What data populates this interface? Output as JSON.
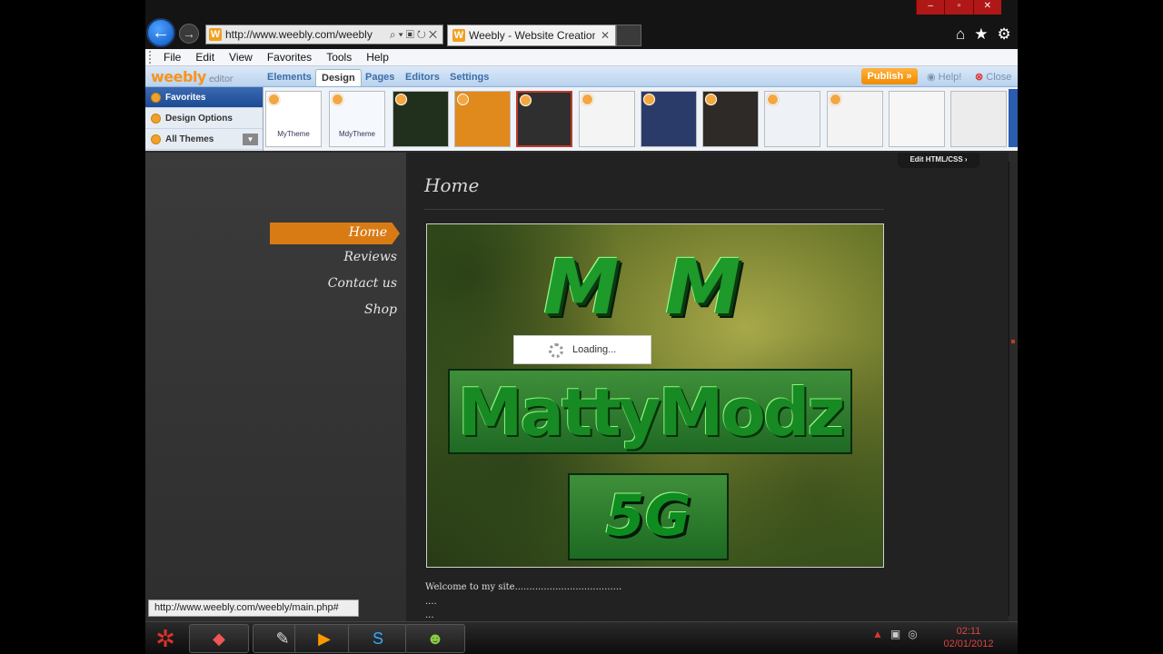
{
  "browser": {
    "address": "http://www.weebly.com/weebly",
    "tab_title": "Weebly - Website Creation ...",
    "tab_close": "✕",
    "menu": [
      "File",
      "Edit",
      "View",
      "Favorites",
      "Tools",
      "Help"
    ]
  },
  "editor": {
    "logo": "weebly",
    "logo_suffix": "editor",
    "tabs": [
      "Elements",
      "Design",
      "Pages",
      "Editors",
      "Settings"
    ],
    "active_tab": "Design",
    "publish": "Publish »",
    "help": "Help!",
    "close": "Close"
  },
  "design_panel": {
    "items": [
      "Favorites",
      "Design Options",
      "All Themes"
    ],
    "selected": "Favorites",
    "themes": [
      {
        "caption": "MyTheme",
        "color": "#ffffff"
      },
      {
        "caption": "MdyTheme",
        "color": "#f5f8fc"
      },
      {
        "caption": "",
        "color": "#20301c"
      },
      {
        "caption": "",
        "color": "#e08a1e"
      },
      {
        "caption": "",
        "color": "#2f2f2f"
      },
      {
        "caption": "",
        "color": "#f4f4f4"
      },
      {
        "caption": "",
        "color": "#2a3b6a"
      },
      {
        "caption": "",
        "color": "#2d2a28"
      },
      {
        "caption": "",
        "color": "#eef1f5"
      },
      {
        "caption": "",
        "color": "#f3f3f3"
      },
      {
        "caption": "",
        "color": "#f6f6f6"
      },
      {
        "caption": "",
        "color": "#ececec"
      }
    ]
  },
  "edit_html_css": "Edit HTML/CSS ›",
  "site": {
    "nav": [
      "Home",
      "Reviews",
      "Contact us",
      "Shop"
    ],
    "active_nav": "Home",
    "page_title": "Home",
    "loading": "Loading...",
    "welcome": "Welcome to my site.....................................",
    "dots1": "....",
    "dots2": "...",
    "banner_letters": [
      "M",
      "M"
    ],
    "banner_logo": "MattyModz",
    "banner_badge": "5G"
  },
  "status_url": "http://www.weebly.com/weebly/main.php#",
  "taskbar": {
    "time": "02:11",
    "date": "02/01/2012"
  },
  "colors": {
    "accent_orange": "#d97b14",
    "weebly_orange": "#f7931e",
    "clock_red": "#dd4444"
  }
}
